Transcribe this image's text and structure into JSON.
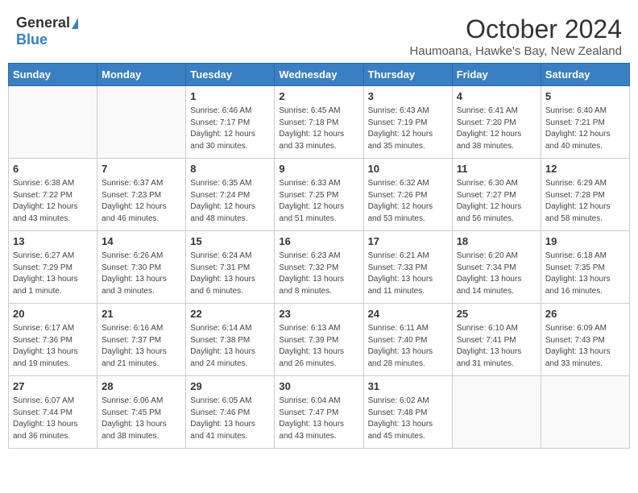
{
  "header": {
    "logo_general": "General",
    "logo_blue": "Blue",
    "month_title": "October 2024",
    "location": "Haumoana, Hawke's Bay, New Zealand"
  },
  "weekdays": [
    "Sunday",
    "Monday",
    "Tuesday",
    "Wednesday",
    "Thursday",
    "Friday",
    "Saturday"
  ],
  "weeks": [
    [
      {
        "day": "",
        "info": ""
      },
      {
        "day": "",
        "info": ""
      },
      {
        "day": "1",
        "info": "Sunrise: 6:46 AM\nSunset: 7:17 PM\nDaylight: 12 hours and 30 minutes."
      },
      {
        "day": "2",
        "info": "Sunrise: 6:45 AM\nSunset: 7:18 PM\nDaylight: 12 hours and 33 minutes."
      },
      {
        "day": "3",
        "info": "Sunrise: 6:43 AM\nSunset: 7:19 PM\nDaylight: 12 hours and 35 minutes."
      },
      {
        "day": "4",
        "info": "Sunrise: 6:41 AM\nSunset: 7:20 PM\nDaylight: 12 hours and 38 minutes."
      },
      {
        "day": "5",
        "info": "Sunrise: 6:40 AM\nSunset: 7:21 PM\nDaylight: 12 hours and 40 minutes."
      }
    ],
    [
      {
        "day": "6",
        "info": "Sunrise: 6:38 AM\nSunset: 7:22 PM\nDaylight: 12 hours and 43 minutes."
      },
      {
        "day": "7",
        "info": "Sunrise: 6:37 AM\nSunset: 7:23 PM\nDaylight: 12 hours and 46 minutes."
      },
      {
        "day": "8",
        "info": "Sunrise: 6:35 AM\nSunset: 7:24 PM\nDaylight: 12 hours and 48 minutes."
      },
      {
        "day": "9",
        "info": "Sunrise: 6:33 AM\nSunset: 7:25 PM\nDaylight: 12 hours and 51 minutes."
      },
      {
        "day": "10",
        "info": "Sunrise: 6:32 AM\nSunset: 7:26 PM\nDaylight: 12 hours and 53 minutes."
      },
      {
        "day": "11",
        "info": "Sunrise: 6:30 AM\nSunset: 7:27 PM\nDaylight: 12 hours and 56 minutes."
      },
      {
        "day": "12",
        "info": "Sunrise: 6:29 AM\nSunset: 7:28 PM\nDaylight: 12 hours and 58 minutes."
      }
    ],
    [
      {
        "day": "13",
        "info": "Sunrise: 6:27 AM\nSunset: 7:29 PM\nDaylight: 13 hours and 1 minute."
      },
      {
        "day": "14",
        "info": "Sunrise: 6:26 AM\nSunset: 7:30 PM\nDaylight: 13 hours and 3 minutes."
      },
      {
        "day": "15",
        "info": "Sunrise: 6:24 AM\nSunset: 7:31 PM\nDaylight: 13 hours and 6 minutes."
      },
      {
        "day": "16",
        "info": "Sunrise: 6:23 AM\nSunset: 7:32 PM\nDaylight: 13 hours and 8 minutes."
      },
      {
        "day": "17",
        "info": "Sunrise: 6:21 AM\nSunset: 7:33 PM\nDaylight: 13 hours and 11 minutes."
      },
      {
        "day": "18",
        "info": "Sunrise: 6:20 AM\nSunset: 7:34 PM\nDaylight: 13 hours and 14 minutes."
      },
      {
        "day": "19",
        "info": "Sunrise: 6:18 AM\nSunset: 7:35 PM\nDaylight: 13 hours and 16 minutes."
      }
    ],
    [
      {
        "day": "20",
        "info": "Sunrise: 6:17 AM\nSunset: 7:36 PM\nDaylight: 13 hours and 19 minutes."
      },
      {
        "day": "21",
        "info": "Sunrise: 6:16 AM\nSunset: 7:37 PM\nDaylight: 13 hours and 21 minutes."
      },
      {
        "day": "22",
        "info": "Sunrise: 6:14 AM\nSunset: 7:38 PM\nDaylight: 13 hours and 24 minutes."
      },
      {
        "day": "23",
        "info": "Sunrise: 6:13 AM\nSunset: 7:39 PM\nDaylight: 13 hours and 26 minutes."
      },
      {
        "day": "24",
        "info": "Sunrise: 6:11 AM\nSunset: 7:40 PM\nDaylight: 13 hours and 28 minutes."
      },
      {
        "day": "25",
        "info": "Sunrise: 6:10 AM\nSunset: 7:41 PM\nDaylight: 13 hours and 31 minutes."
      },
      {
        "day": "26",
        "info": "Sunrise: 6:09 AM\nSunset: 7:43 PM\nDaylight: 13 hours and 33 minutes."
      }
    ],
    [
      {
        "day": "27",
        "info": "Sunrise: 6:07 AM\nSunset: 7:44 PM\nDaylight: 13 hours and 36 minutes."
      },
      {
        "day": "28",
        "info": "Sunrise: 6:06 AM\nSunset: 7:45 PM\nDaylight: 13 hours and 38 minutes."
      },
      {
        "day": "29",
        "info": "Sunrise: 6:05 AM\nSunset: 7:46 PM\nDaylight: 13 hours and 41 minutes."
      },
      {
        "day": "30",
        "info": "Sunrise: 6:04 AM\nSunset: 7:47 PM\nDaylight: 13 hours and 43 minutes."
      },
      {
        "day": "31",
        "info": "Sunrise: 6:02 AM\nSunset: 7:48 PM\nDaylight: 13 hours and 45 minutes."
      },
      {
        "day": "",
        "info": ""
      },
      {
        "day": "",
        "info": ""
      }
    ]
  ]
}
